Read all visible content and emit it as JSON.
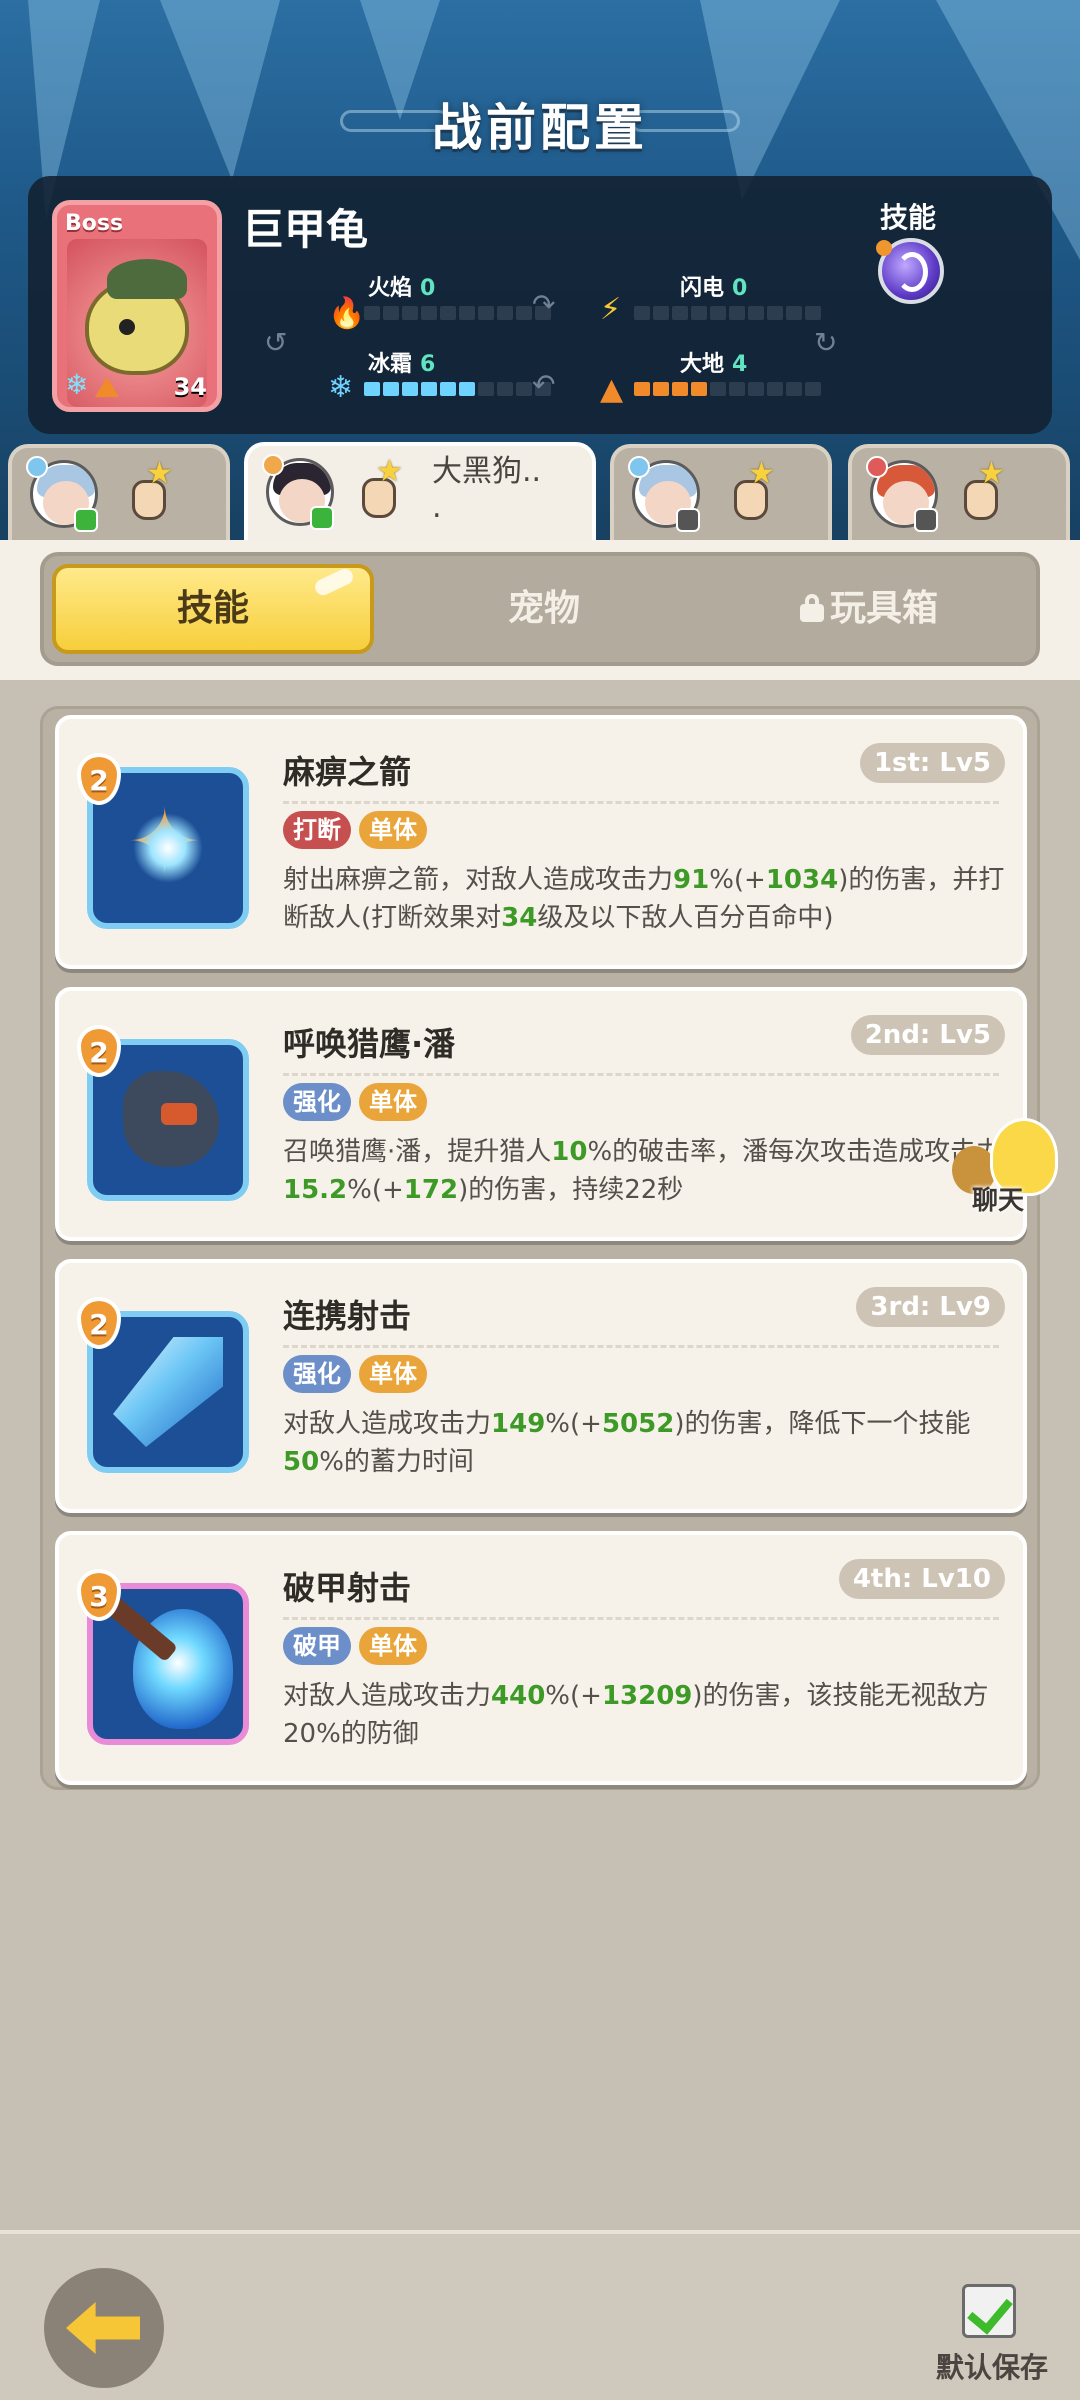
{
  "header": {
    "title": "战前配置"
  },
  "boss": {
    "tag": "Boss",
    "name": "巨甲龟",
    "level": "34",
    "elements": {
      "fire": {
        "label": "火焰",
        "value": "0",
        "level": 0
      },
      "lightning": {
        "label": "闪电",
        "value": "0",
        "level": 0
      },
      "frost": {
        "label": "冰霜",
        "value": "6",
        "level": 6
      },
      "earth": {
        "label": "大地",
        "value": "4",
        "level": 4
      }
    },
    "skill_label": "技能"
  },
  "heroes": [
    {
      "name": "",
      "active": false,
      "hair": "#a9c6e3",
      "badge": "#3cb33a"
    },
    {
      "name": "大黑狗..\n.",
      "active": true,
      "hair": "#2a2530",
      "badge": "#3cb33a"
    },
    {
      "name": "",
      "active": false,
      "hair": "#a9c6e3",
      "badge": "#555555"
    },
    {
      "name": "",
      "active": false,
      "hair": "#d8583a",
      "badge": "#555555"
    }
  ],
  "tabs": {
    "skill": "技能",
    "pet": "宠物",
    "toybox": "玩具箱"
  },
  "skills": [
    {
      "cost": "2",
      "name": "麻痹之箭",
      "level": "1st: Lv5",
      "tags": [
        {
          "text": "打断",
          "color": "red"
        },
        {
          "text": "单体",
          "color": "gold"
        }
      ],
      "desc_parts": [
        "射出麻痹之箭，对敌人造成攻击力",
        "91",
        "%(+",
        "1034",
        ")的伤害，并打断敌人(打断效果对",
        "34",
        "级及以下敌人百分百命中)"
      ]
    },
    {
      "cost": "2",
      "name": "呼唤猎鹰·潘",
      "level": "2nd: Lv5",
      "tags": [
        {
          "text": "强化",
          "color": "blue"
        },
        {
          "text": "单体",
          "color": "gold"
        }
      ],
      "desc_parts": [
        "召唤猎鹰·潘，提升猎人",
        "10",
        "%的破击率，潘每次攻击造成攻击力",
        "15.2",
        "%(+",
        "172",
        ")的伤害，持续22秒"
      ]
    },
    {
      "cost": "2",
      "name": "连携射击",
      "level": "3rd: Lv9",
      "tags": [
        {
          "text": "强化",
          "color": "blue"
        },
        {
          "text": "单体",
          "color": "gold"
        }
      ],
      "desc_parts": [
        "对敌人造成攻击力",
        "149",
        "%(+",
        "5052",
        ")的伤害，降低下一个技能",
        "50",
        "%的蓄力时间"
      ]
    },
    {
      "cost": "3",
      "name": "破甲射击",
      "level": "4th: Lv10",
      "tags": [
        {
          "text": "破甲",
          "color": "blue"
        },
        {
          "text": "单体",
          "color": "gold"
        }
      ],
      "desc_parts": [
        "对敌人造成攻击力",
        "440",
        "%(+",
        "13209",
        ")的伤害，该技能无视敌方20%的防御"
      ]
    }
  ],
  "chat": {
    "label": "聊天"
  },
  "footer": {
    "save_label": "默认保存"
  }
}
